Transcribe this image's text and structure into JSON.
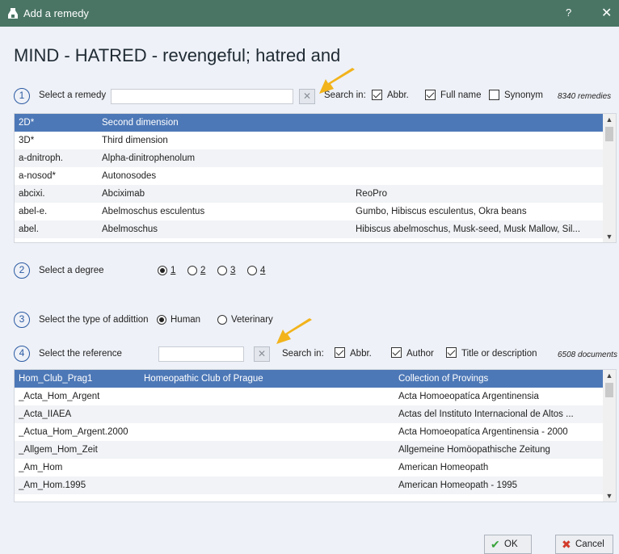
{
  "window": {
    "title": "Add a remedy",
    "help": "?",
    "close": "✕"
  },
  "heading": "MIND - HATRED - revengeful; hatred and",
  "step1": {
    "num": "1",
    "label": "Select a remedy",
    "search_value": "",
    "clear": "✕",
    "search_in": "Search in:",
    "options": [
      {
        "label": "Abbr.",
        "checked": true
      },
      {
        "label": "Full name",
        "checked": true
      },
      {
        "label": "Synonym",
        "checked": false
      }
    ],
    "count": "8340 remedies",
    "rows": [
      {
        "abbr": "2D*",
        "name": "Second dimension",
        "synonym": ""
      },
      {
        "abbr": "3D*",
        "name": "Third dimension",
        "synonym": ""
      },
      {
        "abbr": "a-dnitroph.",
        "name": "Alpha-dinitrophenolum",
        "synonym": ""
      },
      {
        "abbr": "a-nosod*",
        "name": "Autonosodes",
        "synonym": ""
      },
      {
        "abbr": "abcixi.",
        "name": "Abciximab",
        "synonym": "ReoPro"
      },
      {
        "abbr": "abel-e.",
        "name": "Abelmoschus esculentus",
        "synonym": "Gumbo, Hibiscus esculentus, Okra beans"
      },
      {
        "abbr": "abel.",
        "name": "Abelmoschus",
        "synonym": "Hibiscus abelmoschus, Musk-seed, Musk Mallow, Sil..."
      }
    ]
  },
  "step2": {
    "num": "2",
    "label": "Select a degree",
    "degrees": [
      {
        "label": "1",
        "selected": true
      },
      {
        "label": "2",
        "selected": false
      },
      {
        "label": "3",
        "selected": false
      },
      {
        "label": "4",
        "selected": false
      }
    ]
  },
  "step3": {
    "num": "3",
    "label": "Select the type of addittion",
    "types": [
      {
        "label": "Human",
        "selected": true
      },
      {
        "label": "Veterinary",
        "selected": false
      }
    ]
  },
  "step4": {
    "num": "4",
    "label": "Select the reference",
    "search_value": "",
    "clear": "✕",
    "search_in": "Search in:",
    "options": [
      {
        "label": "Abbr.",
        "checked": true
      },
      {
        "label": "Author",
        "checked": true
      },
      {
        "label": "Title or description",
        "checked": true
      }
    ],
    "count": "6508 documents",
    "rows": [
      {
        "abbr": "Hom_Club_Prag1",
        "author": "Homeopathic Club of Prague",
        "title": "Collection of Provings"
      },
      {
        "abbr": "_Acta_Hom_Argent",
        "author": "",
        "title": "Acta Homoeopatíca Argentinensia"
      },
      {
        "abbr": "_Acta_IIAEA",
        "author": "",
        "title": "Actas del Instituto Internacional de Altos ..."
      },
      {
        "abbr": "_Actua_Hom_Argent.2000",
        "author": "",
        "title": "Acta Homoeopatíca Argentinensia - 2000"
      },
      {
        "abbr": "_Allgem_Hom_Zeit",
        "author": "",
        "title": "Allgemeine Homöopathische Zeitung"
      },
      {
        "abbr": "_Am_Hom",
        "author": "",
        "title": "American Homeopath"
      },
      {
        "abbr": "_Am_Hom.1995",
        "author": "",
        "title": "American Homeopath - 1995"
      }
    ]
  },
  "buttons": {
    "ok": "OK",
    "cancel": "Cancel"
  },
  "colors": {
    "titlebar": "#4a7565",
    "selection": "#4d78b7",
    "accent_arrow": "#f2b31b",
    "ok_check": "#3aa43a",
    "cancel_x": "#d23b2b"
  }
}
